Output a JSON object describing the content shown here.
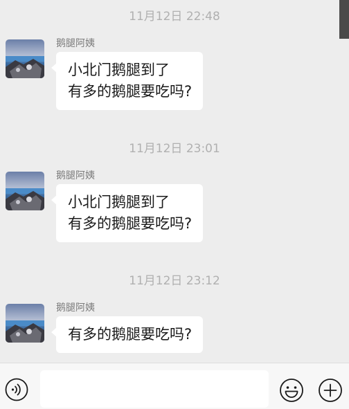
{
  "messages": [
    {
      "timestamp": "11月12日 22:48",
      "sender": "鹅腿阿姨",
      "lines": [
        "小北门鹅腿到了",
        "有多的鹅腿要吃吗?"
      ]
    },
    {
      "timestamp": "11月12日 23:01",
      "sender": "鹅腿阿姨",
      "lines": [
        "小北门鹅腿到了",
        "有多的鹅腿要吃吗?"
      ]
    },
    {
      "timestamp": "11月12日 23:12",
      "sender": "鹅腿阿姨",
      "lines": [
        "有多的鹅腿要吃吗?"
      ]
    }
  ],
  "input_bar": {
    "text_value": "",
    "voice_icon": "voice-icon",
    "emoji_icon": "emoji-icon",
    "plus_icon": "plus-icon"
  },
  "colors": {
    "background": "#ededed",
    "bubble": "#ffffff",
    "timestamp": "#b0b0b0",
    "sender": "#7c7c7c"
  }
}
